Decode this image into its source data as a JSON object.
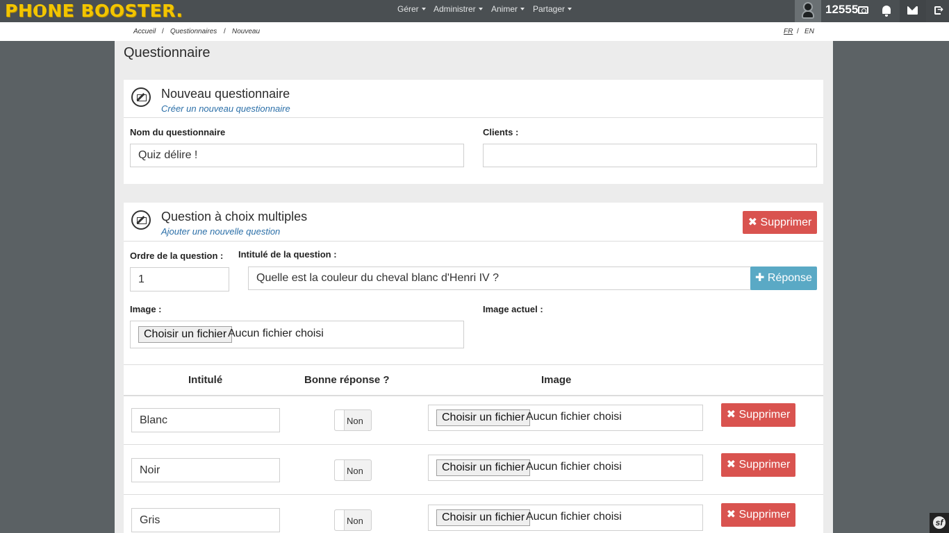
{
  "brand": {
    "logo_text_1": "PH",
    "logo_text_2": "NE BOOSTER."
  },
  "nav": {
    "menus": [
      "Gérer",
      "Administrer",
      "Animer",
      "Partager"
    ],
    "points": "12555"
  },
  "breadcrumb": {
    "items": [
      "Accueil",
      "Questionnaires",
      "Nouveau"
    ],
    "separator": "/"
  },
  "languages": [
    "FR",
    "EN"
  ],
  "page": {
    "title": "Questionnaire"
  },
  "questionnaire_panel": {
    "title": "Nouveau questionnaire",
    "subtitle": "Créer un nouveau questionnaire",
    "name_label": "Nom du questionnaire",
    "name_value": "Quiz délire !",
    "clients_label": "Clients :",
    "clients_value": ""
  },
  "question_panel": {
    "title": "Question à choix multiples",
    "subtitle": "Ajouter une nouvelle question",
    "delete_label": "Supprimer",
    "order_label": "Ordre de la question :",
    "order_value": "1",
    "text_label": "Intitulé de la question :",
    "text_value": "Quelle est la couleur du cheval blanc d'Henri IV ?",
    "add_answer_label": "Réponse",
    "image_label": "Image :",
    "current_image_label": "Image actuel :",
    "file_button_label": "Choisir un fichier",
    "file_none_label": "Aucun fichier choisi"
  },
  "answers_table": {
    "headers": [
      "Intitulé",
      "Bonne réponse ?",
      "Image"
    ],
    "rows": [
      {
        "label": "Blanc",
        "correct": "Non",
        "file_button": "Choisir un fichier",
        "file_none": "Aucun fichier choisi",
        "delete": "Supprimer"
      },
      {
        "label": "Noir",
        "correct": "Non",
        "file_button": "Choisir un fichier",
        "file_none": "Aucun fichier choisi",
        "delete": "Supprimer"
      },
      {
        "label": "Gris",
        "correct": "Non",
        "file_button": "Choisir un fichier",
        "file_none": "Aucun fichier choisi",
        "delete": "Supprimer"
      }
    ]
  },
  "colors": {
    "danger": "#d9534f",
    "info": "#5aa9c5",
    "brand": "#f2c500",
    "navbar": "#4a4f52"
  }
}
